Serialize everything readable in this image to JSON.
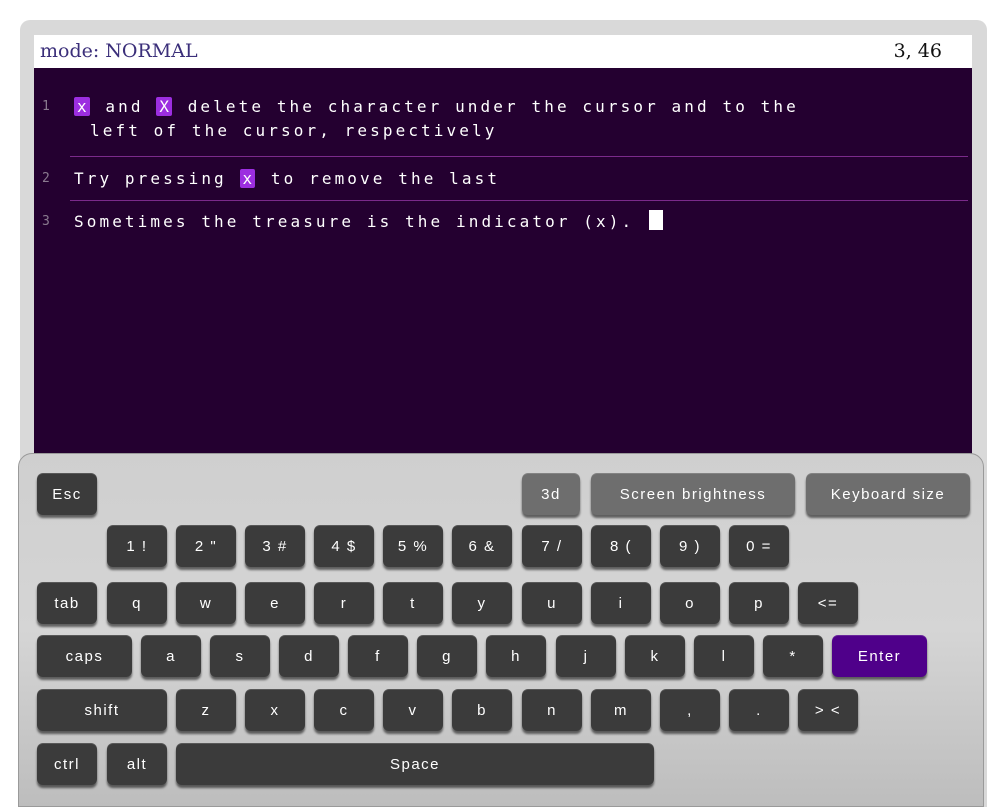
{
  "status": {
    "mode": "mode: NORMAL",
    "position": "3, 46"
  },
  "editor": {
    "lines": [
      {
        "num": "1",
        "hl1": "x",
        "mid1": "and",
        "hl2": "X",
        "rest": "delete the character under the cursor and to the",
        "cont": "left of the cursor, respectively"
      },
      {
        "num": "2",
        "pre": "Try pressing",
        "hl": "x",
        "rest": "to remove the last"
      },
      {
        "num": "3",
        "text": "Sometimes the treasure is the indicator (x). "
      }
    ]
  },
  "keyboard": {
    "accent_color": "#4f008a",
    "key_color": "#3b3b3b",
    "editor_bg": "#240030",
    "highlight_color": "#9c2ee0",
    "esc": "Esc",
    "btn_3d": "3d",
    "screen_brightness": "Screen brightness",
    "keyboard_size": "Keyboard size",
    "row_numbers": [
      "1 !",
      "2 \"",
      "3 #",
      "4 $",
      "5 %",
      "6 &",
      "7 /",
      "8 (",
      "9 )",
      "0 ="
    ],
    "row_top": [
      "tab",
      "q",
      "w",
      "e",
      "r",
      "t",
      "y",
      "u",
      "i",
      "o",
      "p",
      "<="
    ],
    "row_home": [
      "caps",
      "a",
      "s",
      "d",
      "f",
      "g",
      "h",
      "j",
      "k",
      "l",
      "*",
      "Enter"
    ],
    "row_bottom": [
      "shift",
      "z",
      "x",
      "c",
      "v",
      "b",
      "n",
      "m",
      ",",
      ".",
      "> <"
    ],
    "row_space": [
      "ctrl",
      "alt",
      "Space"
    ]
  }
}
